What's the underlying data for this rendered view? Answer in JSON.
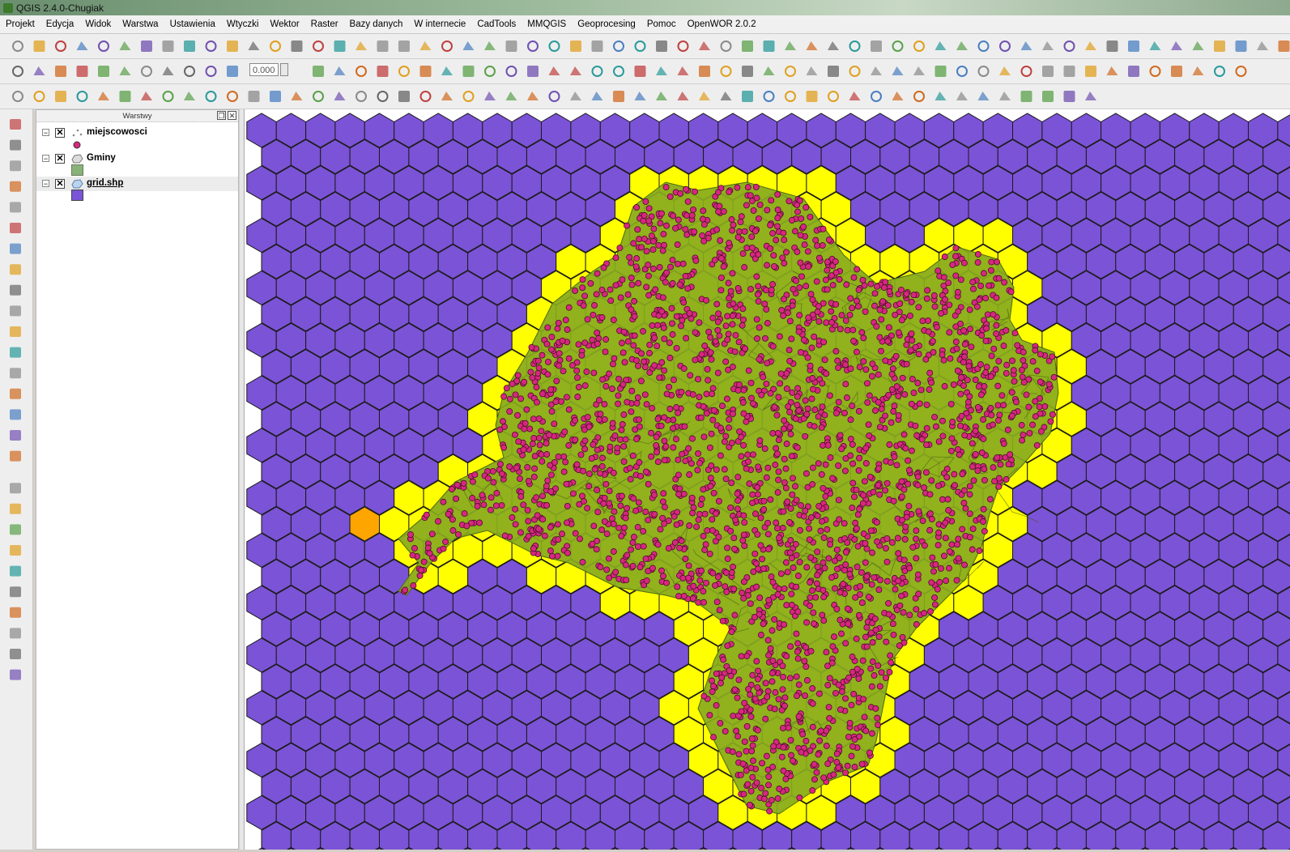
{
  "window": {
    "title": "QGIS 2.4.0-Chugiak"
  },
  "menu": [
    "Projekt",
    "Edycja",
    "Widok",
    "Warstwa",
    "Ustawienia",
    "Wtyczki",
    "Wektor",
    "Raster",
    "Bazy danych",
    "W internecie",
    "CadTools",
    "MMQGIS",
    "Geoprocesing",
    "Pomoc",
    "OpenWOR 2.0.2"
  ],
  "toolbar": {
    "scale_value": "0.000"
  },
  "layers_panel": {
    "title": "Warstwy",
    "layers": [
      {
        "name": "miejscowosci",
        "checked": true,
        "symbol": "point",
        "color": "#d6287f"
      },
      {
        "name": "Gminy",
        "checked": true,
        "symbol": "polygon",
        "color": "#88b27a"
      },
      {
        "name": "grid.shp",
        "checked": true,
        "symbol": "polygon",
        "color": "#7a55d8"
      }
    ]
  },
  "map": {
    "colors": {
      "grid_fill": "#7b53d6",
      "grid_line": "#1a1a1a",
      "highlight": "#ffff00",
      "orange_cell": "#ffa500",
      "gminy_fill": "#88aa20",
      "point_fill": "#d6287f"
    }
  }
}
